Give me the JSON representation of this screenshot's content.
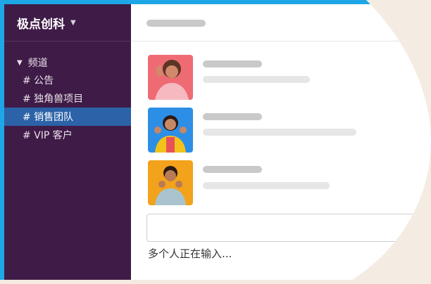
{
  "workspace": {
    "name": "极点创科"
  },
  "sidebar": {
    "section_label": "频道",
    "channels": [
      {
        "label": "# 公告",
        "active": false
      },
      {
        "label": "# 独角兽项目",
        "active": false
      },
      {
        "label": "# 销售团队",
        "active": true
      },
      {
        "label": "# VIP 客户",
        "active": false
      }
    ]
  },
  "status": {
    "typing_text": "多个人正在输入..."
  },
  "colors": {
    "sidebar_bg": "#3f1b47",
    "active_channel": "#2b62a8",
    "accent_blue": "#1ea7e6",
    "page_bg": "#f4ebe2"
  },
  "avatars": [
    {
      "icon": "person-avatar-pink"
    },
    {
      "icon": "person-avatar-blue-yellow"
    },
    {
      "icon": "person-avatar-orange"
    }
  ]
}
